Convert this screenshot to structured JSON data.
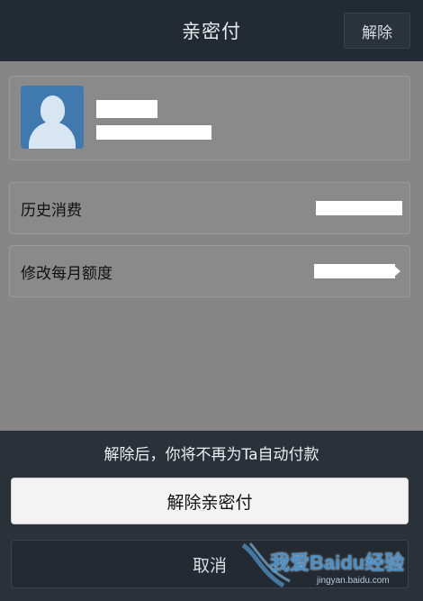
{
  "header": {
    "title": "亲密付",
    "right_button": "解除"
  },
  "profile": {
    "avatar_icon": "user-avatar-icon"
  },
  "rows": [
    {
      "label": "历史消费"
    },
    {
      "label": "修改每月额度"
    }
  ],
  "sheet": {
    "message": "解除后，你将不再为Ta自动付款",
    "primary_button": "解除亲密付",
    "cancel_button": "取消"
  },
  "watermark": {
    "text": "我爱Baidu经验",
    "url": "jingyan.baidu.com"
  },
  "colors": {
    "header_bg": "#222a33",
    "overlay_bg": "#868686",
    "sheet_bg": "#2b3138",
    "avatar_bg": "#3f79ae",
    "primary_button_bg": "#f3f3f3"
  }
}
